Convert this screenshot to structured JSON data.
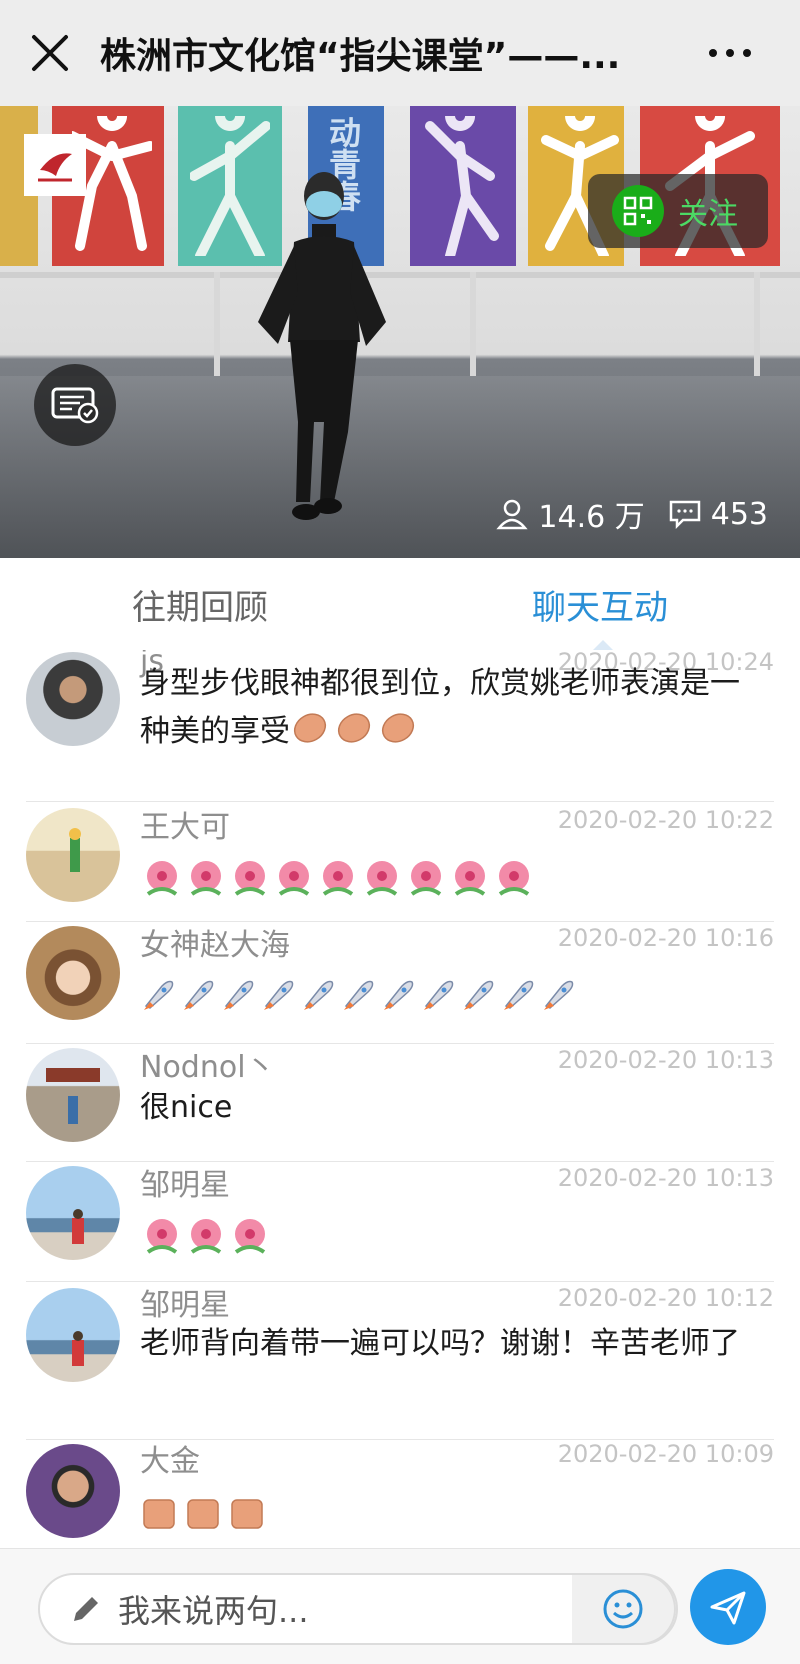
{
  "header": {
    "title": "株洲市文化馆“指尖课堂”——..."
  },
  "video": {
    "wall_text": "动青春",
    "follow_label": "关注",
    "viewers": "14.6 万",
    "comments": "453"
  },
  "tabs": [
    {
      "label": "往期回顾",
      "active": false
    },
    {
      "label": "聊天互动",
      "active": true
    }
  ],
  "messages": [
    {
      "name": "js",
      "time": "2020-02-20 10:24",
      "text": "身型步伐眼神都很到位，欣赏姚老师表演是一种美的享受",
      "emoji": "clapping-hands",
      "emoji_count": 3
    },
    {
      "name": "王大可",
      "time": "2020-02-20 10:22",
      "text": "",
      "emoji": "hibiscus",
      "emoji_count": 9
    },
    {
      "name": "女神赵大海 ",
      "time": "2020-02-20 10:16",
      "text": "",
      "emoji": "rocket",
      "emoji_count": 11
    },
    {
      "name": "Nodnol丶",
      "time": "2020-02-20 10:13",
      "text": "很nice",
      "emoji": "",
      "emoji_count": 0
    },
    {
      "name": "邹明星",
      "time": "2020-02-20 10:13",
      "text": "",
      "emoji": "hibiscus",
      "emoji_count": 3
    },
    {
      "name": "邹明星",
      "time": "2020-02-20 10:12",
      "text": "老师背向着带一遍可以吗？谢谢！辛苦老师了",
      "emoji": "",
      "emoji_count": 0
    },
    {
      "name": "大金",
      "time": "2020-02-20 10:09",
      "text": "",
      "emoji": "thumbs-up",
      "emoji_count": 3
    }
  ],
  "input": {
    "placeholder": "我来说两句..."
  },
  "colors": {
    "accent": "#2a8fd6",
    "follow_green": "#1aad19",
    "send_blue": "#2196e8"
  }
}
